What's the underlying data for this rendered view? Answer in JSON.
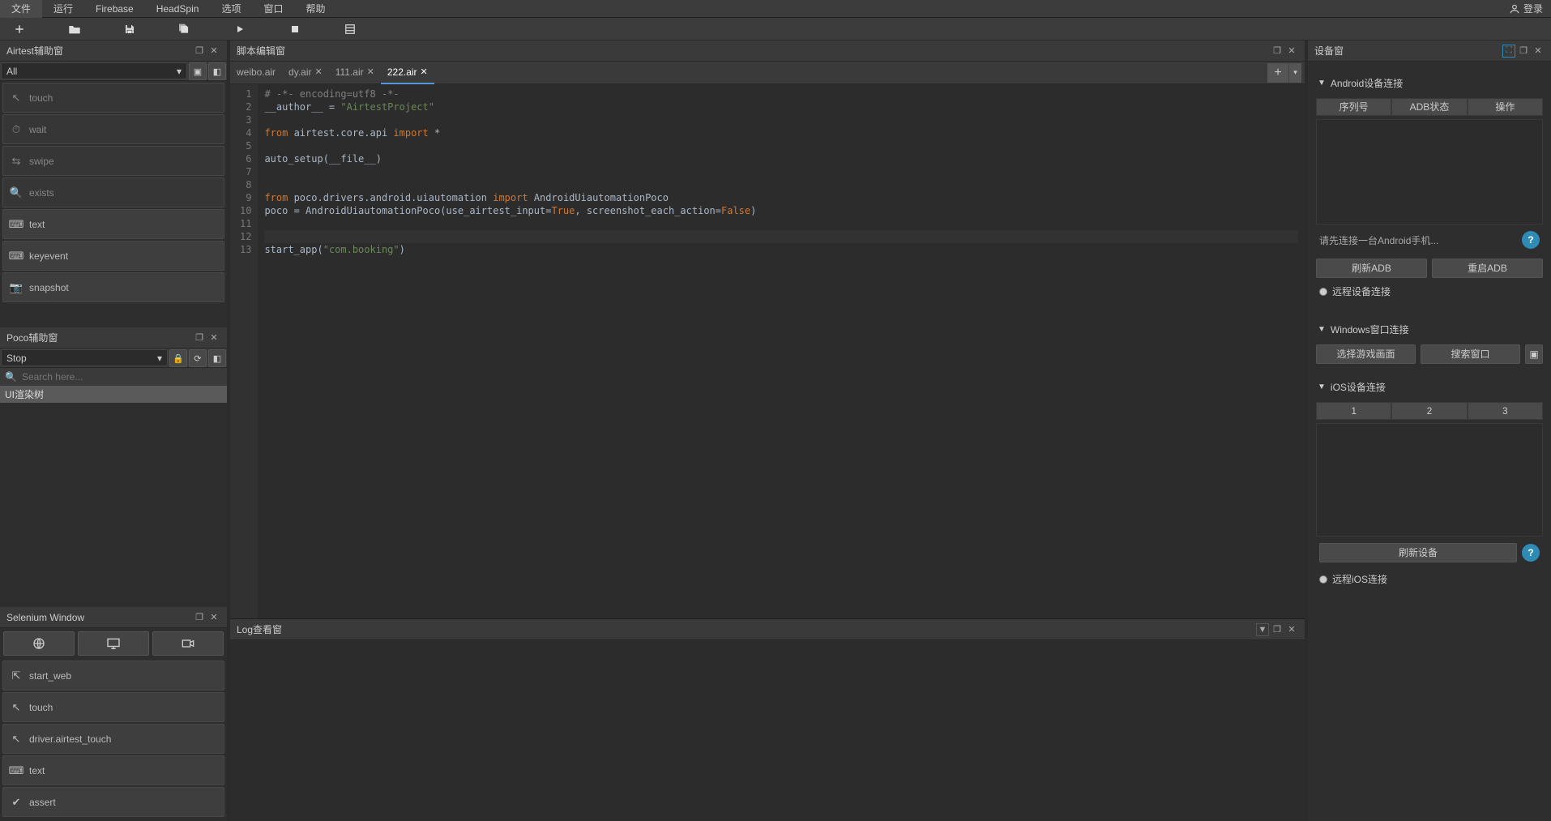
{
  "menu": [
    "文件",
    "运行",
    "Firebase",
    "HeadSpin",
    "选项",
    "窗口",
    "帮助"
  ],
  "login": "登录",
  "panels": {
    "airtest": {
      "title": "Airtest辅助窗",
      "select": "All"
    },
    "poco": {
      "title": "Poco辅助窗",
      "select": "Stop",
      "search_ph": "Search here...",
      "tree": "UI渲染树"
    },
    "selenium": {
      "title": "Selenium Window"
    },
    "editor": {
      "title": "脚本编辑窗"
    },
    "log": {
      "title": "Log查看窗"
    },
    "device": {
      "title": "设备窗"
    }
  },
  "airtest_items": [
    {
      "icon": "touch",
      "label": "touch",
      "dim": true
    },
    {
      "icon": "wait",
      "label": "wait",
      "dim": true
    },
    {
      "icon": "swipe",
      "label": "swipe",
      "dim": true
    },
    {
      "icon": "exists",
      "label": "exists",
      "dim": true
    },
    {
      "icon": "text",
      "label": "text",
      "dim": false
    },
    {
      "icon": "keyevent",
      "label": "keyevent",
      "dim": false
    },
    {
      "icon": "snapshot",
      "label": "snapshot",
      "dim": false
    }
  ],
  "selenium_items": [
    {
      "icon": "startweb",
      "label": "start_web"
    },
    {
      "icon": "touch",
      "label": "touch"
    },
    {
      "icon": "touch",
      "label": "driver.airtest_touch"
    },
    {
      "icon": "text",
      "label": "text"
    },
    {
      "icon": "assert",
      "label": "assert"
    }
  ],
  "tabs": [
    {
      "label": "weibo.air",
      "active": false,
      "closable": false
    },
    {
      "label": "dy.air",
      "active": false,
      "closable": true
    },
    {
      "label": "111.air",
      "active": false,
      "closable": true
    },
    {
      "label": "222.air",
      "active": true,
      "closable": true
    }
  ],
  "code_lines": [
    {
      "n": 1,
      "html": "<span class='com'># -*- encoding=utf8 -*-</span>"
    },
    {
      "n": 2,
      "html": "__author__ = <span class='str'>\"AirtestProject\"</span>"
    },
    {
      "n": 3,
      "html": ""
    },
    {
      "n": 4,
      "html": "<span class='kw'>from</span> airtest.core.api <span class='kw'>import</span> *"
    },
    {
      "n": 5,
      "html": ""
    },
    {
      "n": 6,
      "html": "auto_setup(__file__)"
    },
    {
      "n": 7,
      "html": ""
    },
    {
      "n": 8,
      "html": ""
    },
    {
      "n": 9,
      "html": "<span class='kw'>from</span> poco.drivers.android.uiautomation <span class='kw'>import</span> AndroidUiautomationPoco"
    },
    {
      "n": 10,
      "html": "poco = AndroidUiautomationPoco(use_airtest_input=<span class='bool'>True</span>, screenshot_each_action=<span class='bool'>False</span>)"
    },
    {
      "n": 11,
      "html": ""
    },
    {
      "n": 12,
      "html": "",
      "hl": true
    },
    {
      "n": 13,
      "html": "start_app(<span class='str'>\"com.booking\"</span>)"
    }
  ],
  "device": {
    "android_title": "Android设备连接",
    "cols": [
      "序列号",
      "ADB状态",
      "操作"
    ],
    "hint": "请先连接一台Android手机...",
    "refresh": "刷新ADB",
    "restart": "重启ADB",
    "remote": "远程设备连接",
    "win_title": "Windows窗口连接",
    "win_select": "选择游戏画面",
    "win_search": "搜索窗口",
    "ios_title": "iOS设备连接",
    "ios_cols": [
      "1",
      "2",
      "3"
    ],
    "ios_refresh": "刷新设备",
    "ios_remote": "远程iOS连接"
  }
}
